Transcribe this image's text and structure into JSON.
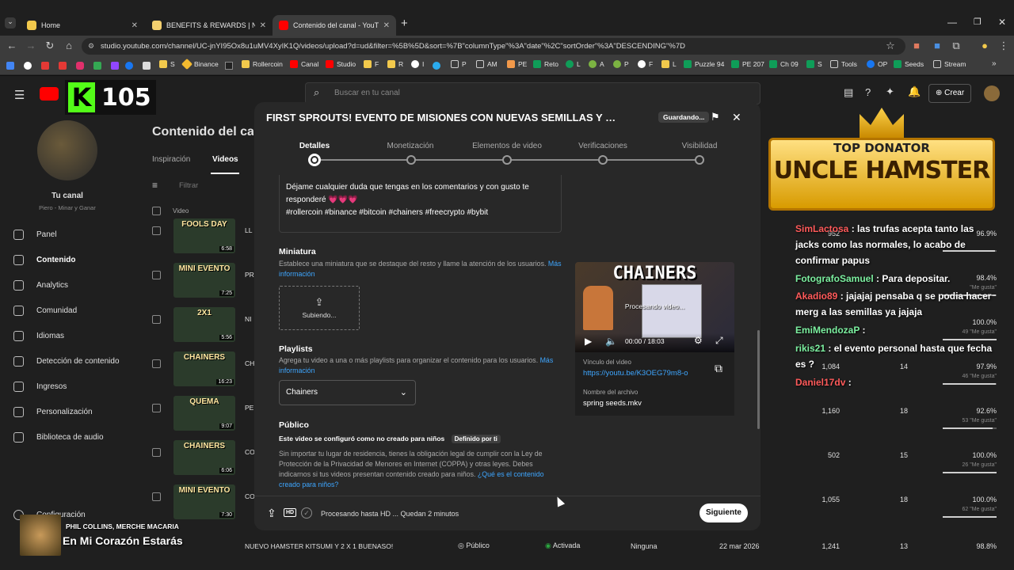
{
  "browser": {
    "tabs": [
      {
        "label": "Home"
      },
      {
        "label": "BENEFITS & REWARDS | Notion"
      },
      {
        "label": "Contenido del canal - YouTube"
      }
    ],
    "new_tab": "+",
    "url": "studio.youtube.com/channel/UC-jnYI95Ox8u1uMV4XyIK1Q/videos/upload?d=ud&filter=%5B%5D&sort=%7B\"columnType\"%3A\"date\"%2C\"sortOrder\"%3A\"DESCENDING\"%7D",
    "bookmarks": [
      "S",
      "Binance",
      "Rollercoin",
      "Canal",
      "Studio",
      "F",
      "R",
      "I",
      "P",
      "AM",
      "PE",
      "Reto",
      "L",
      "A",
      "P",
      "F",
      "L",
      "Puzzle 94",
      "PE 207",
      "Ch 09",
      "S",
      "Tools",
      "OP",
      "Seeds",
      "Stream"
    ]
  },
  "studio": {
    "search_placeholder": "Buscar en tu canal",
    "create_label": "Crear",
    "page_title": "Contenido del canal",
    "tabs": [
      "Inspiración",
      "Videos"
    ],
    "filter_label": "Filtrar",
    "column_video": "Video",
    "channel_name": "Tu canal",
    "channel_sub": "Piero - Minar y Ganar",
    "sidebar": [
      "Panel",
      "Contenido",
      "Analytics",
      "Comunidad",
      "Idiomas",
      "Detección de contenido",
      "Ingresos",
      "Personalización",
      "Biblioteca de audio"
    ],
    "sidebar_bottom": "Configuración",
    "rows": [
      {
        "thumb": "FOOLS DAY",
        "dur": "6:58",
        "title": "LL",
        "views": "952",
        "comments": "",
        "pct": "96.9%",
        "sub": "",
        "fill": 0.97
      },
      {
        "thumb": "MINI EVENTO",
        "dur": "7:25",
        "title": "PR",
        "views": "",
        "comments": "",
        "pct": "98.4%",
        "sub": "\"Me gusta\"",
        "fill": 0.98
      },
      {
        "thumb": "2X1",
        "dur": "5:56",
        "title": "NI",
        "views": "",
        "comments": "",
        "pct": "100.0%",
        "sub": "49 \"Me gusta\"",
        "fill": 1.0
      },
      {
        "thumb": "CHAINERS",
        "dur": "16:23",
        "title": "CH",
        "views": "1,084",
        "comments": "14",
        "pct": "97.9%",
        "sub": "46 \"Me gusta\"",
        "fill": 0.98
      },
      {
        "thumb": "QUEMA",
        "dur": "9:07",
        "title": "PE",
        "views": "1,160",
        "comments": "18",
        "pct": "92.6%",
        "sub": "53 \"Me gusta\"",
        "fill": 0.93
      },
      {
        "thumb": "CHAINERS",
        "dur": "6:06",
        "title": "CO",
        "views": "502",
        "comments": "15",
        "pct": "100.0%",
        "sub": "26 \"Me gusta\"",
        "fill": 1.0
      },
      {
        "thumb": "MINI EVENTO",
        "dur": "7:30",
        "title": "CO",
        "views": "1,055",
        "comments": "18",
        "pct": "100.0%",
        "sub": "62 \"Me gusta\"",
        "fill": 1.0
      }
    ],
    "last_row": {
      "title": "NUEVO HAMSTER KITSUMI Y 2 X 1 BUENASO!",
      "visibility": "Público",
      "monetization": "Activada",
      "restrictions": "Ninguna",
      "date": "22 mar 2026",
      "views": "1,241",
      "comments": "13",
      "pct": "98.8%"
    }
  },
  "overlay": {
    "counter": "105",
    "donator_top": "TOP DONATOR",
    "donator_name": "UNCLE HAMSTER",
    "chat": [
      {
        "user": "SimLactosa",
        "text": "las trufas acepta tanto las jacks como las normales, lo acabo de confirmar papus",
        "userColor": "red"
      },
      {
        "user": "FotografoSamuel",
        "text": "Para depositar.",
        "userColor": "green"
      },
      {
        "user": "Akadio89",
        "text": "jajajaj pensaba q se podia hacer merg a las semillas ya jajaja",
        "userColor": "red"
      },
      {
        "user": "EmiMendozaP",
        "text": "",
        "userColor": "green"
      },
      {
        "user": "rikis21",
        "text": "el evento personal hasta que fecha es ?",
        "userColor": "green"
      },
      {
        "user": "Daniel17dv",
        "text": "",
        "userColor": "red"
      }
    ],
    "song_artist": "PHIL COLLINS, MERCHE MACARIA",
    "song_title": "En Mi Corazón Estarás"
  },
  "modal": {
    "title": "FIRST SPROUTS! EVENTO DE MISIONES CON NUEVAS SEMILLAS Y RATI...",
    "saving": "Guardando...",
    "steps": [
      "Detalles",
      "Monetización",
      "Elementos de video",
      "Verificaciones",
      "Visibilidad"
    ],
    "description_lines": [
      "Déjame cualquier duda que tengas en los comentarios y con gusto te",
      "responderé 💗💗💗",
      "#rollercoin #binance #bitcoin #chainers #freecrypto #bybit"
    ],
    "thumbnail": {
      "heading": "Miniatura",
      "text": "Establece una miniatura que se destaque del resto y llame la atención de los usuarios.",
      "link": "Más información",
      "uploading": "Subiendo..."
    },
    "playlists": {
      "heading": "Playlists",
      "text": "Agrega tu video a una o más playlists para organizar el contenido para los usuarios.",
      "link": "Más información",
      "selected": "Chainers"
    },
    "audience": {
      "heading": "Público",
      "status": "Este video se configuró como no creado para niños",
      "badge": "Definido por ti",
      "text": "Sin importar tu lugar de residencia, tienes la obligación legal de cumplir con la Ley de Protección de la Privacidad de Menores en Internet (COPPA) y otras leyes. Debes indicarnos si tus videos presentan contenido creado para niños.",
      "link": "¿Qué es el contenido creado para niños?"
    },
    "player": {
      "banner": "CHAINERS",
      "processing": "Procesando video...",
      "time": "00:00 / 18:03"
    },
    "video_link_label": "Vínculo del video",
    "video_link": "https://youtu.be/K3OEG79m8-o",
    "filename_label": "Nombre del archivo",
    "filename": "spring seeds.mkv",
    "footer_status": "Procesando hasta HD ... Quedan 2 minutos",
    "hd_label": "HD",
    "next": "Siguiente"
  }
}
